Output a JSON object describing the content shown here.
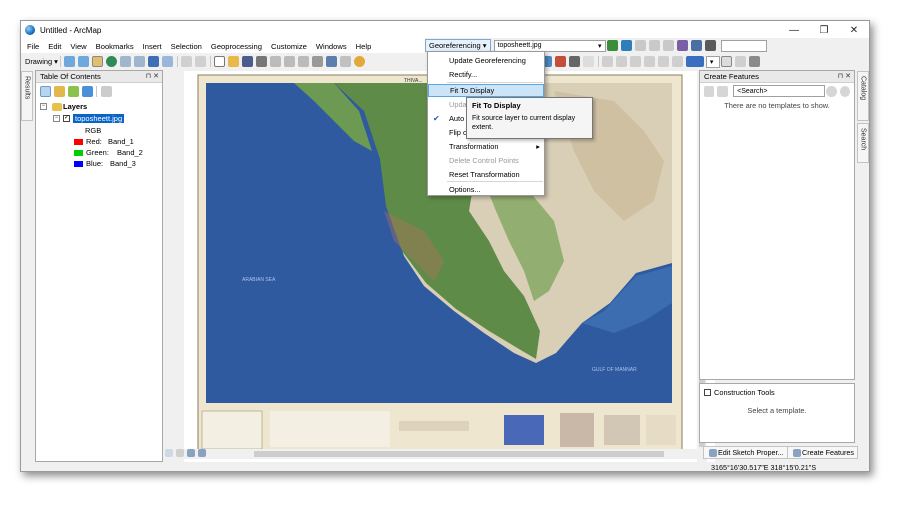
{
  "window": {
    "title": "Untitled - ArcMap",
    "minimize": "—",
    "maximize": "❐",
    "close": "✕"
  },
  "menu": [
    "File",
    "Edit",
    "View",
    "Bookmarks",
    "Insert",
    "Selection",
    "Geoprocessing",
    "Customize",
    "Windows",
    "Help"
  ],
  "toolbars": {
    "drawing_label": "Drawing",
    "georef_menu_label": "Georeferencing",
    "layer_dropdown": "toposheett.jpg",
    "search_box_value": ""
  },
  "georef_menu": {
    "items": [
      {
        "label": "Update Georeferencing",
        "enabled": true
      },
      {
        "label": "Rectify...",
        "enabled": true
      },
      {
        "label": "Fit To Display",
        "enabled": true,
        "highlighted": true
      },
      {
        "label": "Update Display",
        "enabled": false
      },
      {
        "label": "Auto Adjust",
        "enabled": true,
        "checked": true
      },
      {
        "label": "Flip or Rotate",
        "enabled": true
      },
      {
        "label": "Transformation",
        "enabled": true,
        "submenu": true
      },
      {
        "label": "Delete Control Points",
        "enabled": false
      },
      {
        "label": "Reset Transformation",
        "enabled": true
      },
      {
        "label": "Options...",
        "enabled": true
      }
    ],
    "check_mark": "✔",
    "submenu_arrow": "▸"
  },
  "tooltip": {
    "title": "Fit To Display",
    "text": "Fit source layer to current display extent."
  },
  "toc": {
    "title": "Table Of Contents",
    "pin": "⊓ ✕",
    "layers_label": "Layers",
    "layer_name": "toposheett.jpg",
    "rgb_label": "RGB",
    "bands": [
      {
        "label": "Red:",
        "band": "Band_1",
        "color": "#ff0000"
      },
      {
        "label": "Green:",
        "band": "Band_2",
        "color": "#00d000"
      },
      {
        "label": "Blue:",
        "band": "Band_3",
        "color": "#0000ff"
      }
    ]
  },
  "side_tabs": {
    "left": "Results",
    "right_top": "Catalog",
    "right_bottom": "Search"
  },
  "create_features": {
    "title": "Create Features",
    "search_placeholder": "<Search>",
    "empty_message": "There are no templates to show.",
    "construction_title": "Construction Tools",
    "construction_message": "Select a template.",
    "edit_button": "Edit Sketch Proper...",
    "create_button": "Create Features"
  },
  "map": {
    "header_text": "THIVA...",
    "sea_label": "ARABIAN SEA",
    "bay_label": "GULF OF MANNAR"
  },
  "status": {
    "coordinates": "3165°16'30.517\"E  318°15'0.21\"S"
  }
}
